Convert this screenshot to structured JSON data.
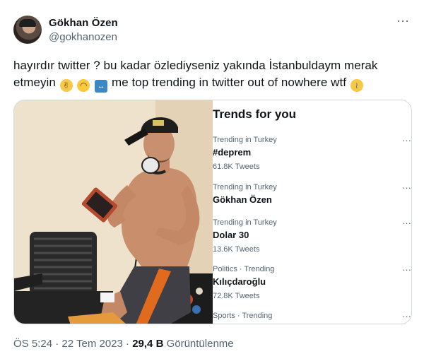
{
  "author": {
    "name": "Gökhan Özen",
    "handle": "@gokhanozen"
  },
  "more_icon": "more-horizontal-icon",
  "tweet": {
    "line1": "hayırdır twitter ? bu kadar özlediyseniz yakında İstanbuldaym merak",
    "line2_a": "etmeyin",
    "line2_b": "me top trending in twitter out of nowhere wtf",
    "emojis": [
      "victory-hand-emoji",
      "upside-down-face-emoji",
      "left-right-arrow-emoji",
      "loudly-crying-face-emoji"
    ]
  },
  "trends_panel": {
    "title": "Trends for you",
    "items": [
      {
        "context": "Trending in Turkey",
        "topic": "#deprem",
        "count": "61.8K Tweets"
      },
      {
        "context": "Trending in Turkey",
        "topic": "Gökhan Özen",
        "count": ""
      },
      {
        "context": "Trending in Turkey",
        "topic": "Dolar 30",
        "count": "13.6K Tweets"
      },
      {
        "context": "Politics · Trending",
        "topic": "Kılıçdaroğlu",
        "count": "72.8K Tweets"
      },
      {
        "context": "Sports · Trending",
        "topic": "",
        "count": ""
      }
    ],
    "item_more": "···"
  },
  "footer": {
    "time": "ÖS 5:24",
    "sep1": "·",
    "date": "22 Tem 2023",
    "sep2": "·",
    "views": "29,4 B",
    "views_label": "Görüntülenme"
  },
  "colors": {
    "text": "#0f1419",
    "secondary": "#536471",
    "border": "#cfd9de"
  }
}
